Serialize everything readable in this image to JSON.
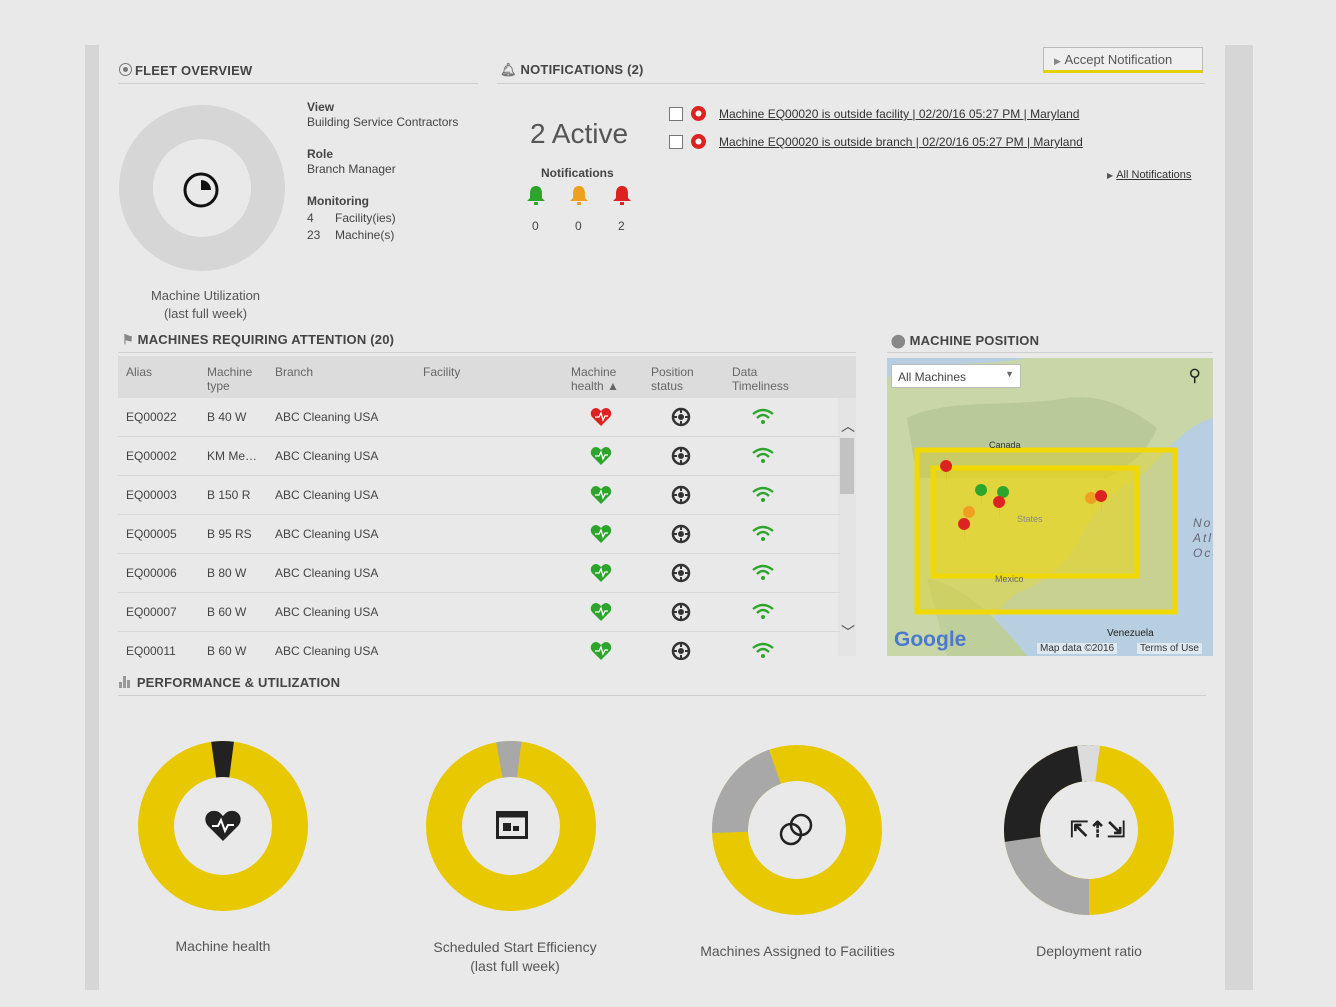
{
  "fleet": {
    "title": "FLEET OVERVIEW",
    "util_label": "Machine Utilization",
    "util_sub": "(last full week)",
    "view_label": "View",
    "view_value": "Building Service Contractors",
    "role_label": "Role",
    "role_value": "Branch Manager",
    "monitoring_label": "Monitoring",
    "facilities_count": "4",
    "facilities_label": "Facility(ies)",
    "machines_count": "23",
    "machines_label": "Machine(s)"
  },
  "notifications": {
    "title": "NOTIFICATIONS (2)",
    "active": "2 Active",
    "sub": "Notifications",
    "green_count": "0",
    "orange_count": "0",
    "red_count": "2",
    "accept_label": "Accept Notification",
    "all_label": "All Notifications",
    "items": [
      {
        "text": "Machine EQ00020 is outside facility | 02/20/16 05:27 PM | Maryland"
      },
      {
        "text": "Machine EQ00020 is outside branch | 02/20/16 05:27 PM | Maryland"
      }
    ]
  },
  "attention": {
    "title": "MACHINES REQUIRING ATTENTION (20)",
    "columns": {
      "alias": "Alias",
      "type1": "Machine",
      "type2": "type",
      "branch": "Branch",
      "facility": "Facility",
      "health1": "Machine",
      "health2": "health ▲",
      "pos1": "Position",
      "pos2": "status",
      "data1": "Data",
      "data2": "Timeliness"
    },
    "rows": [
      {
        "alias": "EQ00022",
        "type": "B 40 W",
        "branch": "ABC Cleaning USA",
        "health": "red"
      },
      {
        "alias": "EQ00002",
        "type": "KM Me…",
        "branch": "ABC Cleaning USA",
        "health": "green"
      },
      {
        "alias": "EQ00003",
        "type": "B 150 R",
        "branch": "ABC Cleaning USA",
        "health": "green"
      },
      {
        "alias": "EQ00005",
        "type": "B 95 RS",
        "branch": "ABC Cleaning USA",
        "health": "green"
      },
      {
        "alias": "EQ00006",
        "type": "B 80 W",
        "branch": "ABC Cleaning USA",
        "health": "green"
      },
      {
        "alias": "EQ00007",
        "type": "B 60 W",
        "branch": "ABC Cleaning USA",
        "health": "green"
      },
      {
        "alias": "EQ00011",
        "type": "B 60 W",
        "branch": "ABC Cleaning USA",
        "health": "green"
      }
    ]
  },
  "map": {
    "title": "MACHINE POSITION",
    "select_value": "All Machines",
    "label_canada": "Canada",
    "label_states": "States",
    "label_mexico": "Mexico",
    "label_venezuela": "Venezuela",
    "label_atlantic1": "No",
    "label_atlantic2": "Atla",
    "label_atlantic3": "Oce",
    "google": "Google",
    "attribution": "Map data ©2016",
    "terms": "Terms of Use"
  },
  "performance": {
    "title": "PERFORMANCE & UTILIZATION",
    "health_label": "Machine health",
    "sched_label": "Scheduled Start Efficiency",
    "sched_sub": "(last full week)",
    "assigned_label": "Machines Assigned to Facilities",
    "deploy_label": "Deployment ratio"
  },
  "colors": {
    "yellow": "#e8c800",
    "dark": "#222222",
    "grey": "#a8a8a8",
    "green": "#2da52d",
    "orange": "#f0a020",
    "red": "#dd2222"
  }
}
